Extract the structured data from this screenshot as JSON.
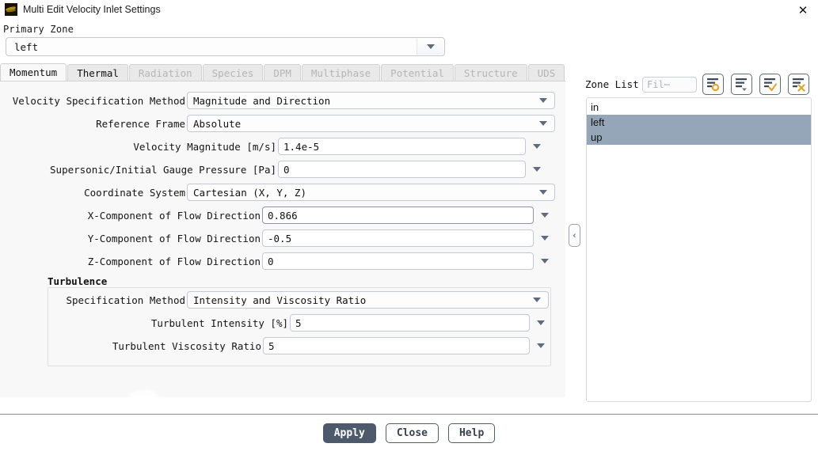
{
  "window": {
    "title": "Multi Edit Velocity Inlet Settings",
    "icon": "fluent-logo-icon",
    "close_label": "✕"
  },
  "primary_zone": {
    "label": "Primary Zone",
    "value": "left"
  },
  "tabs": [
    {
      "label": "Momentum",
      "active": true,
      "enabled": true
    },
    {
      "label": "Thermal",
      "active": false,
      "enabled": true
    },
    {
      "label": "Radiation",
      "active": false,
      "enabled": false
    },
    {
      "label": "Species",
      "active": false,
      "enabled": false
    },
    {
      "label": "DPM",
      "active": false,
      "enabled": false
    },
    {
      "label": "Multiphase",
      "active": false,
      "enabled": false
    },
    {
      "label": "Potential",
      "active": false,
      "enabled": false
    },
    {
      "label": "Structure",
      "active": false,
      "enabled": false
    },
    {
      "label": "UDS",
      "active": false,
      "enabled": false
    }
  ],
  "momentum": {
    "velocity_specification_method": {
      "label": "Velocity Specification Method",
      "value": "Magnitude and Direction"
    },
    "reference_frame": {
      "label": "Reference Frame",
      "value": "Absolute"
    },
    "velocity_magnitude": {
      "label": "Velocity Magnitude [m/s]",
      "value": "1.4e-5"
    },
    "supersonic_initial_gauge_pressure": {
      "label": "Supersonic/Initial Gauge Pressure [Pa]",
      "value": "0"
    },
    "coordinate_system": {
      "label": "Coordinate System",
      "value": "Cartesian (X, Y, Z)"
    },
    "x_component": {
      "label": "X-Component of Flow Direction",
      "value": "0.866"
    },
    "y_component": {
      "label": "Y-Component of Flow Direction",
      "value": "-0.5"
    },
    "z_component": {
      "label": "Z-Component of Flow Direction",
      "value": "0"
    }
  },
  "turbulence": {
    "title": "Turbulence",
    "specification_method": {
      "label": "Specification Method",
      "value": "Intensity and Viscosity Ratio"
    },
    "turbulent_intensity": {
      "label": "Turbulent Intensity [%]",
      "value": "5"
    },
    "turbulent_viscosity_ratio": {
      "label": "Turbulent Viscosity Ratio",
      "value": "5"
    }
  },
  "collapse_handle": {
    "label": "‹"
  },
  "zone_panel": {
    "label": "Zone List",
    "filter_placeholder": "Fil⋯",
    "buttons": [
      {
        "name": "list-highlight-icon"
      },
      {
        "name": "list-sort-icon"
      },
      {
        "name": "list-select-all-icon"
      },
      {
        "name": "list-deselect-all-icon"
      }
    ],
    "zones": [
      {
        "name": "in",
        "selected": false
      },
      {
        "name": "left",
        "selected": true
      },
      {
        "name": "up",
        "selected": true
      }
    ]
  },
  "footer": {
    "apply_label": "Apply",
    "close_label": "Close",
    "help_label": "Help"
  },
  "colors": {
    "accent_orange": "#e8a32d",
    "selection_blue": "#94a6b8",
    "primary_button": "#4e5a6b",
    "panel_bg": "#f8f8f8"
  }
}
